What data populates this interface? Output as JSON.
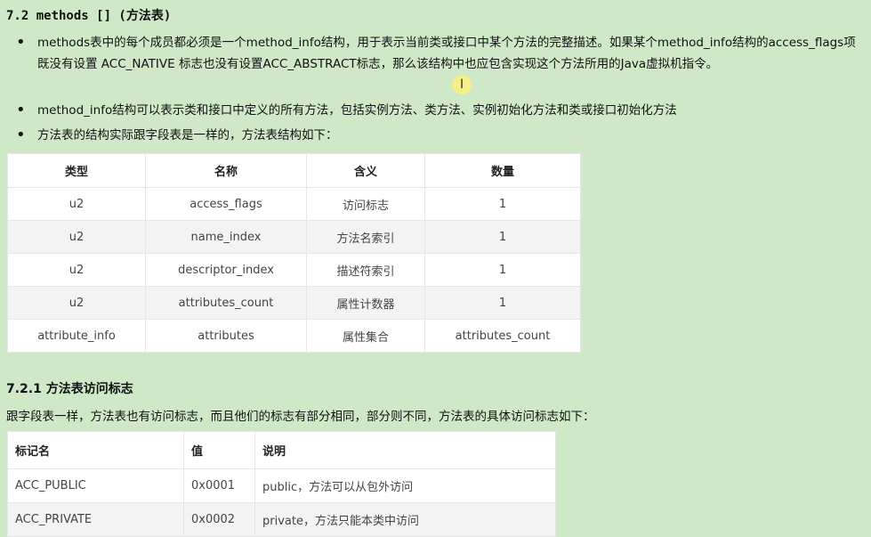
{
  "section": {
    "title": "7.2 methods [] (方法表)"
  },
  "bullets": [
    "methods表中的每个成员都必须是一个method_info结构，用于表示当前类或接口中某个方法的完整描述。如果某个method_info结构的access_flags项既没有设置 ACC_NATIVE 标志也没有设置ACC_ABSTRACT标志，那么该结构中也应包含实现这个方法所用的Java虚拟机指令。",
    "method_info结构可以表示类和接口中定义的所有方法，包括实例方法、类方法、实例初始化方法和类或接口初始化方法",
    "方法表的结构实际跟字段表是一样的，方法表结构如下："
  ],
  "table1": {
    "headers": [
      "类型",
      "名称",
      "含义",
      "数量"
    ],
    "rows": [
      [
        "u2",
        "access_flags",
        "访问标志",
        "1"
      ],
      [
        "u2",
        "name_index",
        "方法名索引",
        "1"
      ],
      [
        "u2",
        "descriptor_index",
        "描述符索引",
        "1"
      ],
      [
        "u2",
        "attributes_count",
        "属性计数器",
        "1"
      ],
      [
        "attribute_info",
        "attributes",
        "属性集合",
        "attributes_count"
      ]
    ]
  },
  "subsection": {
    "title": "7.2.1 方法表访问标志",
    "text": "跟字段表一样，方法表也有访问标志，而且他们的标志有部分相同，部分则不同，方法表的具体访问标志如下："
  },
  "table2": {
    "headers": [
      "标记名",
      "值",
      "说明"
    ],
    "rows": [
      [
        "ACC_PUBLIC",
        "0x0001",
        "public，方法可以从包外访问"
      ],
      [
        "ACC_PRIVATE",
        "0x0002",
        "private，方法只能本类中访问"
      ]
    ]
  },
  "cursor_icon": "text-cursor-icon"
}
